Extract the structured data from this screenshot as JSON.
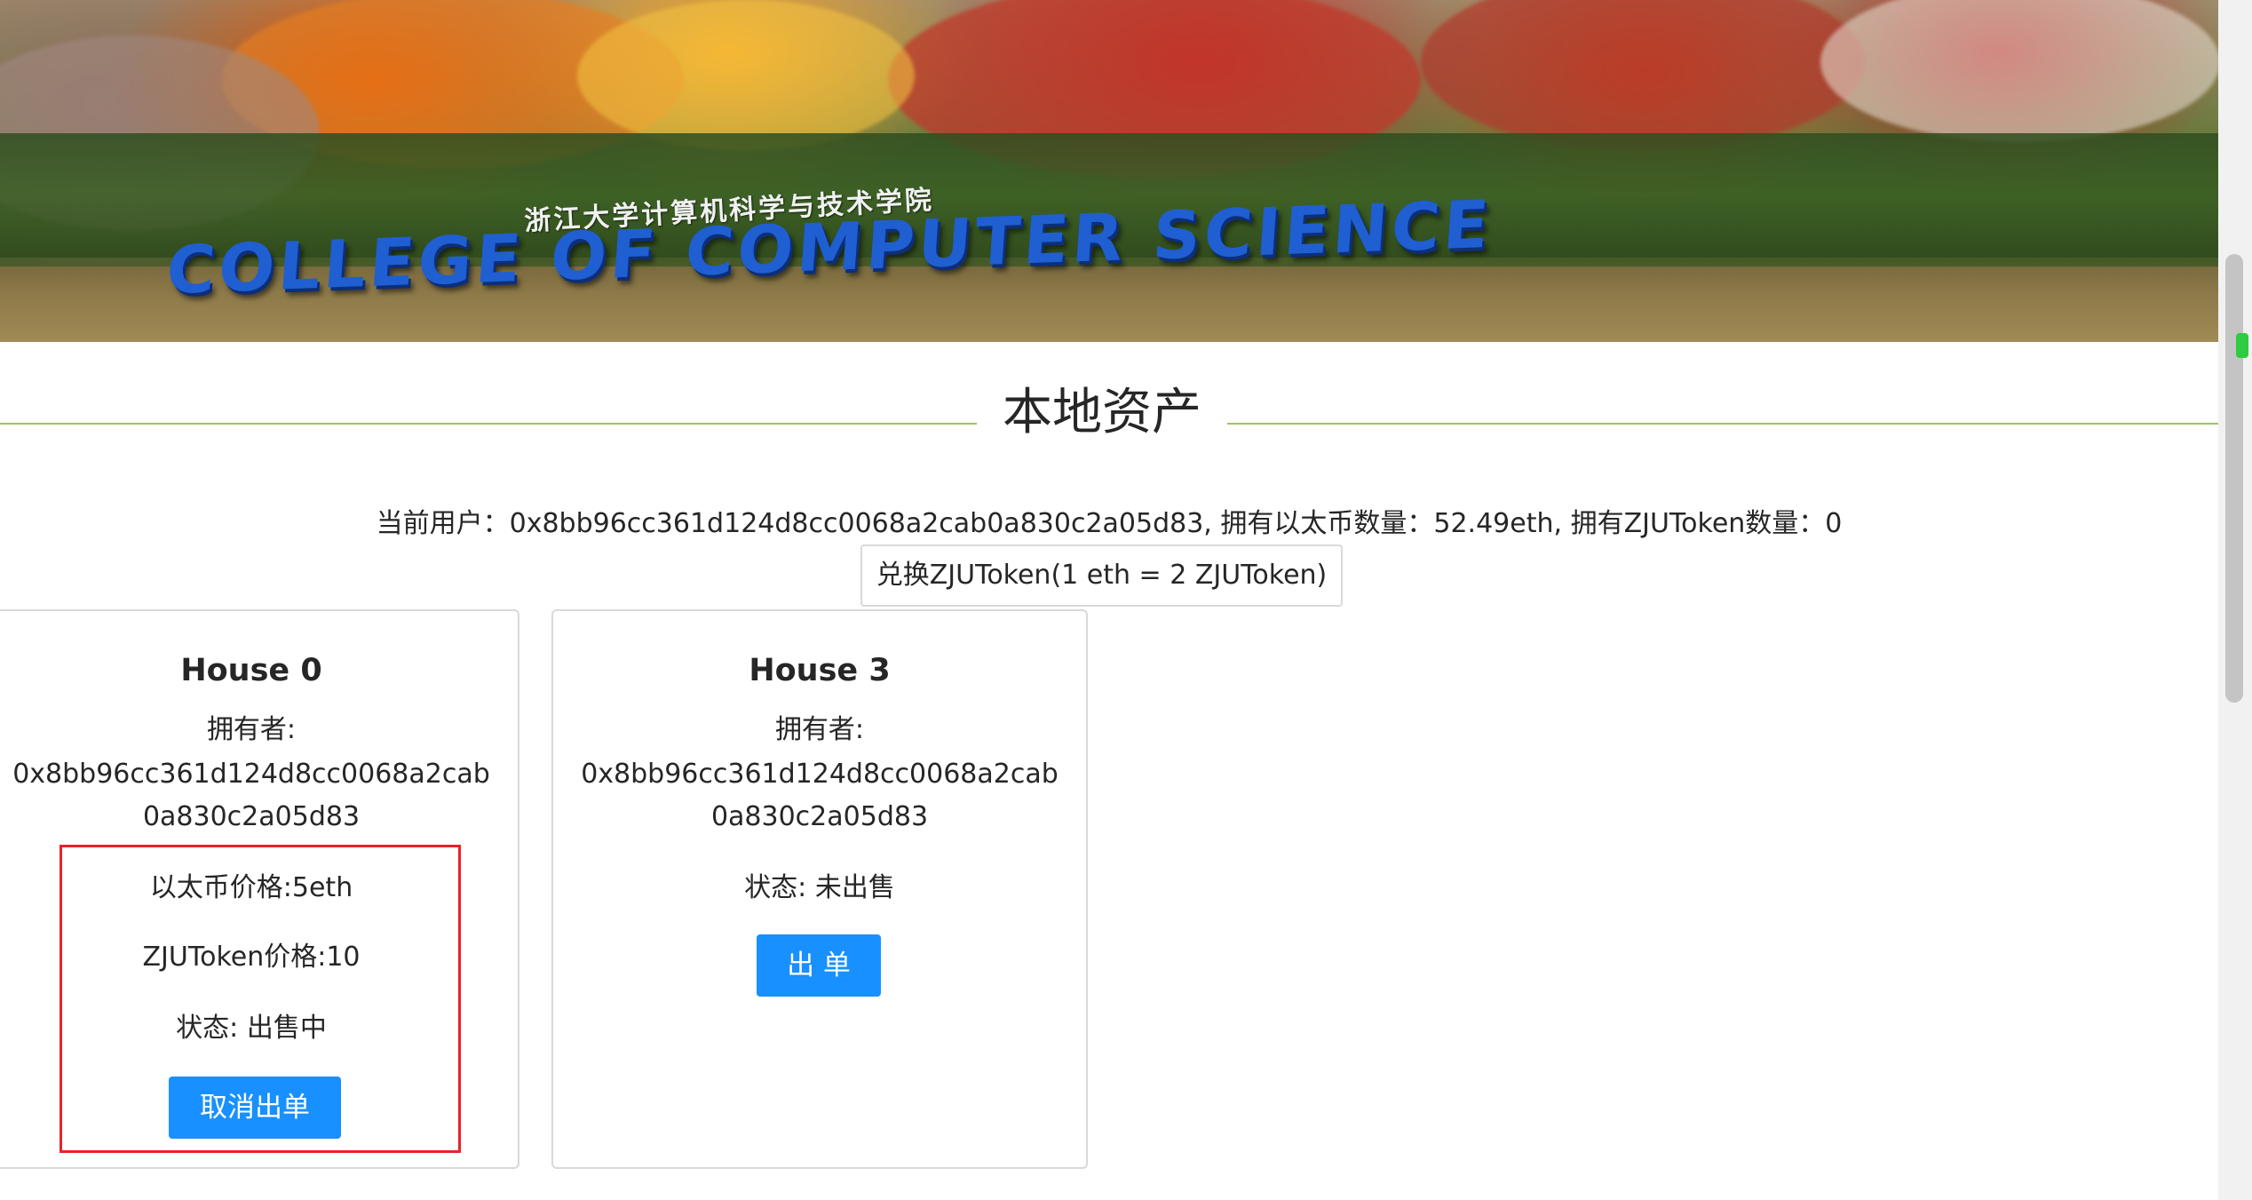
{
  "banner": {
    "sign_cn": "浙江大学计算机科学与技术学院",
    "sign_en": "COLLEGE OF COMPUTER SCIENCE"
  },
  "section": {
    "title": "本地资产"
  },
  "user": {
    "info_text": "当前用户：0x8bb96cc361d124d8cc0068a2cab0a830c2a05d83, 拥有以太币数量：52.49eth, 拥有ZJUToken数量：0"
  },
  "exchange_button": {
    "label": "兑换ZJUToken(1 eth = 2 ZJUToken)"
  },
  "houses": [
    {
      "title": "House 0",
      "owner_label": "拥有者:",
      "owner_address": "0x8bb96cc361d124d8cc0068a2cab0a830c2a05d83",
      "eth_price": "以太币价格:5eth",
      "token_price": "ZJUToken价格:10",
      "status": "状态: 出售中",
      "action_label": "取消出单"
    },
    {
      "title": "House 3",
      "owner_label": "拥有者:",
      "owner_address": "0x8bb96cc361d124d8cc0068a2cab0a830c2a05d83",
      "status": "状态: 未出售",
      "action_label": "出 单"
    }
  ],
  "colors": {
    "primary": "#1890ff",
    "highlight_border": "#e8232a",
    "divider": "#a0c45a"
  }
}
